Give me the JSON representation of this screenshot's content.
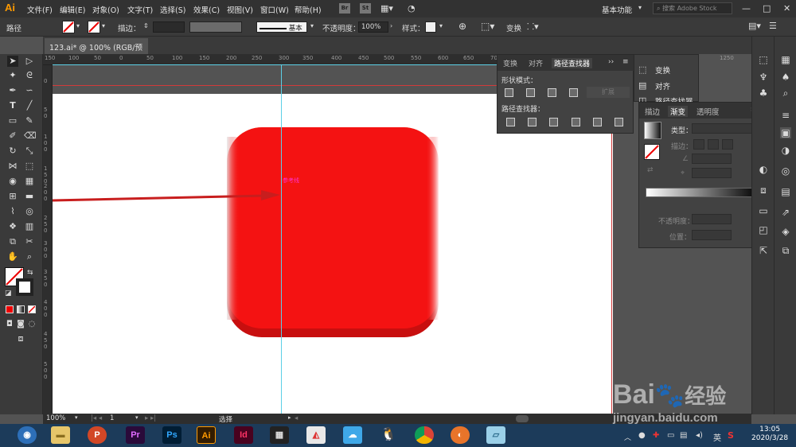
{
  "app": {
    "logo": "Ai"
  },
  "menu": [
    "文件(F)",
    "编辑(E)",
    "对象(O)",
    "文字(T)",
    "选择(S)",
    "效果(C)",
    "视图(V)",
    "窗口(W)",
    "帮助(H)"
  ],
  "bridge_buttons": [
    "Br",
    "St"
  ],
  "workspace": "基本功能",
  "search_placeholder": "搜索 Adobe Stock",
  "window_controls": [
    "—",
    "□",
    "✕"
  ],
  "control_bar": {
    "selection_label": "路径",
    "stroke_label": "描边：",
    "stroke_profile": "基本",
    "opacity_label": "不透明度：",
    "opacity_value": "100%",
    "style_label": "样式：",
    "transform_label": "变换"
  },
  "document_tab": "123.ai* @ 100% (RGB/预览)",
  "ruler_h": [
    "150",
    "100",
    "50",
    "0",
    "50",
    "100",
    "150",
    "200",
    "250",
    "300",
    "350",
    "400",
    "450",
    "500",
    "550",
    "600",
    "650",
    "700",
    "1250"
  ],
  "ruler_v": [
    "0",
    "5\n0",
    "1\n0\n0",
    "1\n5\n0",
    "2\n0\n0",
    "2\n5\n0",
    "3\n0\n0",
    "3\n5\n0",
    "4\n0\n0",
    "4\n5\n0",
    "5\n0\n0"
  ],
  "canvas": {
    "guide_label": "参考线"
  },
  "pathfinder_panel": {
    "tabs": [
      "变换",
      "对齐",
      "路径查找器"
    ],
    "shape_modes_label": "形状模式：",
    "expand_button": "扩展",
    "pathfinders_label": "路径查找器："
  },
  "mini_panel": {
    "items": [
      "变换",
      "对齐",
      "路径查找器"
    ]
  },
  "gradient_panel": {
    "tabs": [
      "描边",
      "渐变",
      "透明度"
    ],
    "type_label": "类型：",
    "stroke_label": "描边：",
    "opacity_label": "不透明度：",
    "position_label": "位置："
  },
  "status_bar": {
    "zoom": "100%",
    "artboard": "1",
    "tool": "选择"
  },
  "taskbar": {
    "apps": [
      "Pr",
      "Ps",
      "Ai",
      "Id"
    ],
    "time": "13:05",
    "date": "2020/3/28"
  },
  "watermark": {
    "brand": "Bai",
    "brand_tail": "经验",
    "url": "jingyan.baidu.com"
  },
  "colors": {
    "shape_fill": "#f41212",
    "shape_edge": "#d40f0f",
    "guide": "#5ccfe6",
    "accent_ai": "#ff9a00"
  }
}
